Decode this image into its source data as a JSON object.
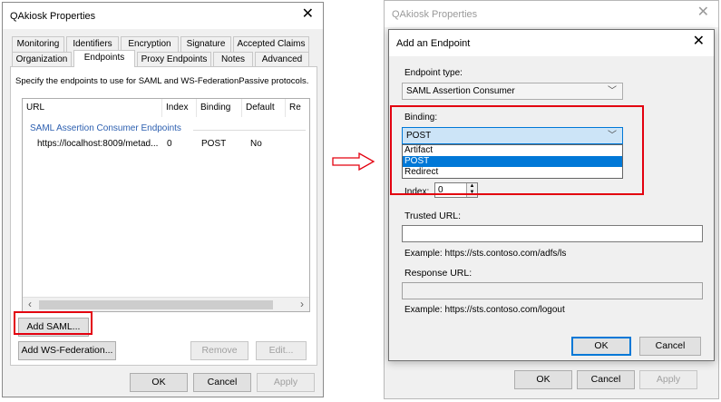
{
  "left_window": {
    "title": "QAkiosk Properties",
    "tabs_row1": [
      "Monitoring",
      "Identifiers",
      "Encryption",
      "Signature",
      "Accepted Claims"
    ],
    "tabs_row2": [
      "Organization",
      "Endpoints",
      "Proxy Endpoints",
      "Notes",
      "Advanced"
    ],
    "active_tab": "Endpoints",
    "description": "Specify the endpoints to use for SAML and WS-FederationPassive protocols.",
    "columns": [
      "URL",
      "Index",
      "Binding",
      "Default",
      "Re"
    ],
    "group_label": "SAML Assertion Consumer Endpoints",
    "rows": [
      {
        "url": "https://localhost:8009/metad...",
        "index": "0",
        "binding": "POST",
        "default": "No"
      }
    ],
    "buttons": {
      "add_saml": "Add SAML...",
      "add_wsfed": "Add WS-Federation...",
      "remove": "Remove",
      "edit": "Edit...",
      "ok": "OK",
      "cancel": "Cancel",
      "apply": "Apply"
    }
  },
  "right_window": {
    "title": "QAkiosk Properties",
    "dialog": {
      "title": "Add an Endpoint",
      "endpoint_type_label": "Endpoint type:",
      "endpoint_type_value": "SAML Assertion Consumer",
      "binding_label": "Binding:",
      "binding_value": "POST",
      "binding_options": [
        "Artifact",
        "POST",
        "Redirect"
      ],
      "binding_selected_index": 1,
      "index_label": "Index:",
      "index_value": "0",
      "trusted_url_label": "Trusted URL:",
      "trusted_url_value": "",
      "trusted_url_example": "Example: https://sts.contoso.com/adfs/ls",
      "response_url_label": "Response URL:",
      "response_url_value": "",
      "response_url_example": "Example: https://sts.contoso.com/logout",
      "ok": "OK",
      "cancel": "Cancel"
    },
    "buttons": {
      "ok": "OK",
      "cancel": "Cancel",
      "apply": "Apply"
    }
  },
  "colors": {
    "highlight": "#e3000f",
    "accent": "#0078d7",
    "group_text": "#2c5fb0"
  },
  "icons": {
    "close": "close-icon",
    "arrow": "right-arrow-icon",
    "chevron": "chevron-down-icon"
  }
}
